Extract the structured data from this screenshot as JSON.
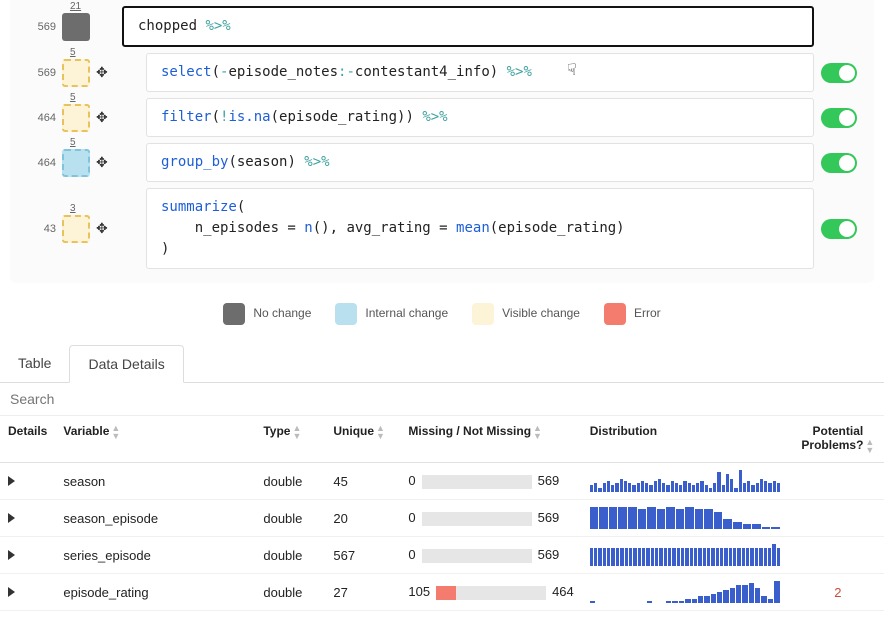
{
  "pipeline": {
    "steps": [
      {
        "rows": "569",
        "cols": "21",
        "thumb": "gray",
        "has_move": false,
        "first": true,
        "code_html": "chopped <span class='tok-teal'>%>%</span>",
        "toggle": false
      },
      {
        "rows": "569",
        "cols": "5",
        "thumb": "vis",
        "has_move": true,
        "first": false,
        "code_html": "<span class='tok-blue'>select</span>(<span class='tok-teal'>-</span>episode_notes<span class='tok-teal'>:-</span>contestant4_info) <span class='tok-teal'>%>%</span>",
        "toggle": true
      },
      {
        "rows": "464",
        "cols": "5",
        "thumb": "vis",
        "has_move": true,
        "first": false,
        "code_html": "<span class='tok-blue'>filter</span>(<span class='tok-teal'>!</span><span class='tok-blue'>is.na</span>(episode_rating)) <span class='tok-teal'>%>%</span>",
        "toggle": true
      },
      {
        "rows": "464",
        "cols": "5",
        "thumb": "int",
        "has_move": true,
        "first": false,
        "code_html": "<span class='tok-blue'>group_by</span>(season) <span class='tok-teal'>%>%</span>",
        "toggle": true
      },
      {
        "rows": "43",
        "cols": "3",
        "thumb": "vis",
        "has_move": true,
        "first": false,
        "code_html": "<span class='tok-blue'>summarize</span>(\n    n_episodes = <span class='tok-blue'>n</span>(), avg_rating = <span class='tok-blue'>mean</span>(episode_rating)\n)",
        "toggle": true
      }
    ]
  },
  "legend": {
    "no_change": "No change",
    "internal": "Internal change",
    "visible": "Visible change",
    "error": "Error"
  },
  "tabs": {
    "table": "Table",
    "data_details": "Data Details"
  },
  "search": {
    "placeholder": "Search"
  },
  "headers": {
    "details": "Details",
    "variable": "Variable",
    "type": "Type",
    "unique": "Unique",
    "missing": "Missing / Not Missing",
    "distribution": "Distribution",
    "problems": "Potential Problems?"
  },
  "rows": [
    {
      "variable": "season",
      "type": "double",
      "unique": "45",
      "missing": "0",
      "notmissing": "569",
      "dist": [
        3,
        4,
        2,
        4,
        5,
        3,
        4,
        6,
        5,
        4,
        3,
        4,
        5,
        4,
        3,
        5,
        6,
        4,
        3,
        5,
        4,
        3,
        5,
        4,
        3,
        4,
        5,
        3,
        2,
        4,
        9,
        3,
        8,
        6,
        2,
        10,
        4,
        5,
        3,
        4,
        6,
        5,
        4,
        5,
        4
      ],
      "problems": ""
    },
    {
      "variable": "season_episode",
      "type": "double",
      "unique": "20",
      "missing": "0",
      "notmissing": "569",
      "dist": [
        9,
        9,
        9,
        9,
        9,
        8,
        9,
        8,
        9,
        8,
        9,
        8,
        8,
        7,
        4,
        3,
        2,
        2,
        1,
        1
      ],
      "problems": ""
    },
    {
      "variable": "series_episode",
      "type": "double",
      "unique": "567",
      "missing": "0",
      "notmissing": "569",
      "dist": [
        8,
        8,
        8,
        8,
        8,
        8,
        8,
        8,
        8,
        8,
        8,
        8,
        8,
        8,
        8,
        8,
        8,
        8,
        8,
        8,
        8,
        8,
        8,
        8,
        8,
        8,
        8,
        8,
        8,
        8,
        8,
        8,
        8,
        8,
        8,
        8,
        8,
        8,
        8,
        8,
        8,
        8,
        10,
        8
      ],
      "problems": ""
    },
    {
      "variable": "episode_rating",
      "type": "double",
      "unique": "27",
      "missing": "105",
      "notmissing": "464",
      "dist": [
        1,
        0,
        0,
        0,
        0,
        0,
        0,
        0,
        0,
        1,
        0,
        0,
        1,
        1,
        1,
        2,
        2,
        3,
        3,
        4,
        5,
        6,
        7,
        8,
        8,
        9,
        7,
        3,
        2,
        10
      ],
      "problems": "2"
    }
  ]
}
